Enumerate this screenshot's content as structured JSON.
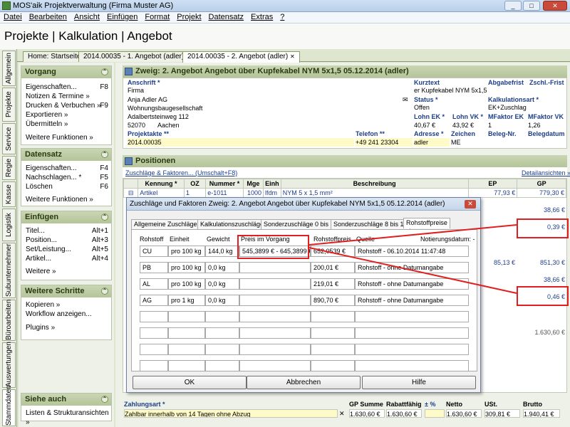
{
  "window": {
    "title": "MOS'aik Projektverwaltung (Firma Muster AG)",
    "minimize": "_",
    "maximize": "□",
    "close": "✕"
  },
  "menu": [
    "Datei",
    "Bearbeiten",
    "Ansicht",
    "Einfügen",
    "Format",
    "Projekt",
    "Datensatz",
    "Extras",
    "?"
  ],
  "page_heading": "Projekte | Kalkulation | Angebot",
  "vertical_tabs": [
    "Allgemein",
    "Projekte",
    "Service",
    "Regie",
    "Kasse",
    "Logistik",
    "Subunternehmer",
    "Büroarbeiten",
    "Auswertungen",
    "Stammdaten"
  ],
  "doc_tabs": [
    "Home: Startseite",
    "2014.00035 - 1. Angebot (adler)",
    "2014.00035 - 2. Angebot (adler)"
  ],
  "doc_tab_close": "✕",
  "sidebar": {
    "vorgang": {
      "title": "Vorgang",
      "items": [
        {
          "label": "Eigenschaften...",
          "key": "F8"
        },
        {
          "label": "Notizen & Termine »",
          "key": ""
        },
        {
          "label": "Drucken & Verbuchen »",
          "key": "F9"
        },
        {
          "label": "Exportieren »",
          "key": ""
        },
        {
          "label": "Übermitteln »",
          "key": ""
        }
      ],
      "more": "Weitere Funktionen »"
    },
    "datensatz": {
      "title": "Datensatz",
      "items": [
        {
          "label": "Eigenschaften...",
          "key": "F4"
        },
        {
          "label": "Nachschlagen... *",
          "key": "F5"
        },
        {
          "label": "Löschen",
          "key": "F6"
        }
      ],
      "more": "Weitere Funktionen »"
    },
    "einfuegen": {
      "title": "Einfügen",
      "items": [
        {
          "label": "Titel...",
          "key": "Alt+1"
        },
        {
          "label": "Position...",
          "key": "Alt+3"
        },
        {
          "label": "Set/Leistung...",
          "key": "Alt+5"
        },
        {
          "label": "Artikel...",
          "key": "Alt+4"
        }
      ],
      "more": "Weitere »"
    },
    "schritte": {
      "title": "Weitere Schritte",
      "items": [
        "Kopieren »",
        "Workflow anzeigen...",
        "Plugins »"
      ]
    },
    "siehe": {
      "title": "Siehe auch",
      "items": [
        "Listen & Strukturansichten »"
      ]
    }
  },
  "header_section": {
    "title": "Zweig: 2. Angebot Angebot über Kupfekabel NYM 5x1,5 05.12.2014 (adler)",
    "anschrift_label": "Anschrift *",
    "anschrift": [
      "Firma",
      "Anja Adler AG",
      "Wohnungsbaugesellschaft",
      "Adalbertsteinweg 112"
    ],
    "plz": "52070",
    "ort": "Aachen",
    "projektakte_label": "Projektakte **",
    "projektakte": "2014.00035",
    "telefon_label": "Telefon **",
    "telefon": "+49 241 23304",
    "kurztext_label": "Kurztext",
    "kurztext": "er Kupfekabel NYM 5x1,5",
    "abgabefrist_label": "Abgabefrist",
    "zschl_label": "Zschl.-Frist",
    "status_label": "Status *",
    "status": "Offen",
    "kalkart_label": "Kalkulationsart *",
    "kalkart": "EK+Zuschlag",
    "lohnek_label": "Lohn EK *",
    "lohnek": "40,67 €",
    "lohnvk_label": "Lohn VK *",
    "lohnvk": "43,92 €",
    "mfek_label": "MFaktor EK",
    "mfek": "1",
    "mfvk_label": "MFaktor VK",
    "mfvk": "1,26",
    "adresse_label": "Adresse *",
    "adresse": "adler",
    "zeichen_label": "Zeichen",
    "zeichen": "ME",
    "belegnr_label": "Beleg-Nr.",
    "belegdatum_label": "Belegdatum"
  },
  "positions": {
    "title": "Positionen",
    "toolbar_link": "Zuschläge & Faktoren... (Umschalt+F8)",
    "details_link": "Detailansichten »",
    "columns": [
      "Kennung *",
      "OZ",
      "Nummer *",
      "Mge",
      "Einh",
      "Beschreibung",
      "EP",
      "GP"
    ],
    "row": {
      "type": "Artikel",
      "oz": "1",
      "nummer": "e-1011",
      "mge": "1000",
      "einh": "lfdm",
      "beschreibung": "NYM 5 x 1,5 mm²",
      "ep": "77,93 €",
      "gp": "779,30 €"
    },
    "side_values": [
      "38,66 €",
      "0,39 €",
      "851,30 €",
      "85,13 €",
      "38,66 €",
      "0,46 €",
      "1.630,60 €"
    ]
  },
  "dialog": {
    "title": "Zuschläge und Faktoren Zweig: 2. Angebot Angebot über Kupfekabel NYM 5x1,5 05.12.2014 (adler)",
    "close": "✕",
    "tabs": [
      "Allgemeine Zuschläge",
      "Kalkulationszuschläge",
      "Sonderzuschläge 0 bis 7",
      "Sonderzuschläge 8 bis 15",
      "Rohstoffpreise"
    ],
    "headers": {
      "rohstoff": "Rohstoff",
      "einheit": "Einheit",
      "gewicht": "Gewicht",
      "preis": "Preis im Vorgang",
      "rohstoffpreis": "Rohstoffpreis",
      "quelle": "Quelle",
      "notierung": "Notierungsdatum: -"
    },
    "rows": [
      {
        "rohstoff": "CU",
        "einheit": "pro 100 kg",
        "gewicht": "144,0 kg",
        "preis": "545,3899 € - 645,3899 €",
        "rohstoffpreis": "652,0539 €",
        "quelle": "Rohstoff - 06.10.2014 11:47:48"
      },
      {
        "rohstoff": "PB",
        "einheit": "pro 100 kg",
        "gewicht": "0,0 kg",
        "preis": "",
        "rohstoffpreis": "200,01 €",
        "quelle": "Rohstoff - ohne Datumangabe"
      },
      {
        "rohstoff": "AL",
        "einheit": "pro 100 kg",
        "gewicht": "0,0 kg",
        "preis": "",
        "rohstoffpreis": "219,01 €",
        "quelle": "Rohstoff - ohne Datumangabe"
      },
      {
        "rohstoff": "AG",
        "einheit": "pro 1 kg",
        "gewicht": "0,0 kg",
        "preis": "",
        "rohstoffpreis": "890,70 €",
        "quelle": "Rohstoff - ohne Datumangabe"
      }
    ],
    "ok": "OK",
    "cancel": "Abbrechen",
    "help": "Hilfe"
  },
  "footer": {
    "zahlungsart_label": "Zahlungsart *",
    "zahlungsart": "Zahlbar innerhalb von 14 Tagen ohne Abzug",
    "gpsumme_label": "GP Summe",
    "gpsumme": "1.630,60 €",
    "rabatt_label": "Rabattfähig",
    "rabatt": "1.630,60 €",
    "proz_label": "± %",
    "proz": "",
    "netto_label": "Netto",
    "netto": "1.630,60 €",
    "ust_label": "USt.",
    "ust": "309,81 €",
    "brutto_label": "Brutto",
    "brutto": "1.940,41 €"
  }
}
